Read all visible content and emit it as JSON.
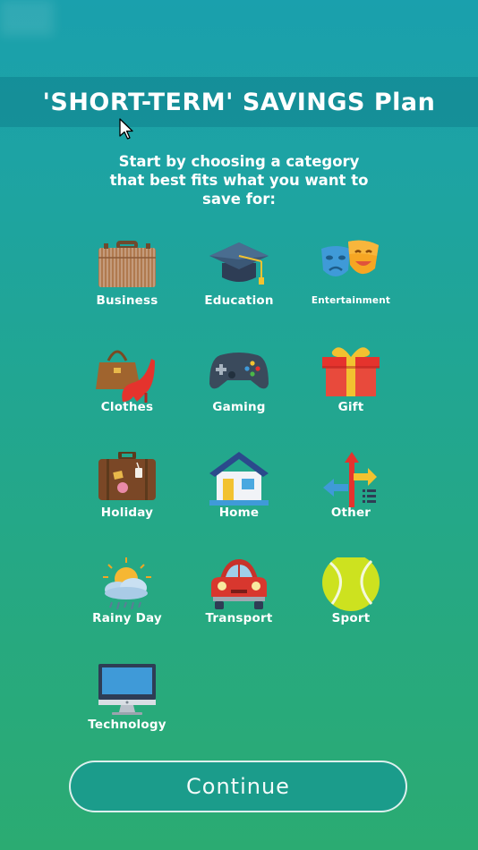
{
  "header": {
    "title": "'SHORT-TERM' SAVINGS Plan"
  },
  "intro": {
    "text": "Start by choosing a category\nthat best fits what you want to\nsave for:"
  },
  "categories": [
    {
      "label": "Business",
      "icon": "briefcase-icon"
    },
    {
      "label": "Education",
      "icon": "graduation-cap-icon"
    },
    {
      "label": "Entertainment",
      "icon": "theater-masks-icon"
    },
    {
      "label": "Clothes",
      "icon": "handbag-heel-icon"
    },
    {
      "label": "Gaming",
      "icon": "gamepad-icon"
    },
    {
      "label": "Gift",
      "icon": "gift-icon"
    },
    {
      "label": "Holiday",
      "icon": "suitcase-icon"
    },
    {
      "label": "Home",
      "icon": "house-icon"
    },
    {
      "label": "Other",
      "icon": "directions-icon"
    },
    {
      "label": "Rainy Day",
      "icon": "weather-icon"
    },
    {
      "label": "Transport",
      "icon": "car-icon"
    },
    {
      "label": "Sport",
      "icon": "tennis-ball-icon"
    },
    {
      "label": "Technology",
      "icon": "monitor-icon"
    }
  ],
  "footer": {
    "continue_label": "Continue"
  },
  "colors": {
    "accent": "#1b9c8b",
    "background_top": "#1aa0ad",
    "background_bottom": "#2bab72"
  }
}
